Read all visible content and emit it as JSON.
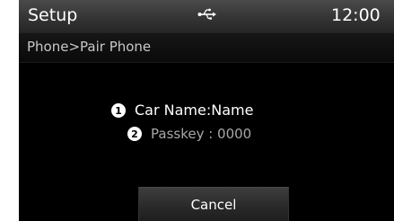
{
  "status_bar": {
    "title": "Setup",
    "usb_icon": "usb-icon",
    "time": "12:00"
  },
  "breadcrumb": "Phone>Pair Phone",
  "info": {
    "car_name_number": "1",
    "car_name": "Car Name:Name",
    "passkey_number": "2",
    "passkey": "Passkey : 0000"
  },
  "buttons": {
    "cancel": "Cancel"
  },
  "colors": {
    "background": "#000000",
    "status_bar": "#3a3a3a",
    "text_primary": "#ffffff",
    "text_secondary": "#a8a8a8"
  }
}
